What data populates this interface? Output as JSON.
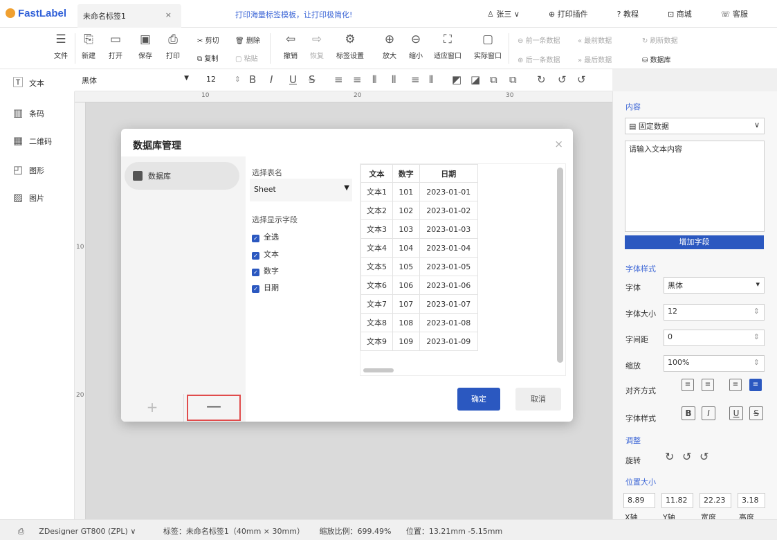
{
  "titlebar": {
    "app_name": "FastLabel",
    "doc_tab": "未命名标签1",
    "doc_close": "×",
    "promo": "打印海量标签模板，让打印极简化!",
    "user": "张三 ∨",
    "links": [
      "打印插件",
      "教程",
      "商城",
      "客服"
    ]
  },
  "toolbar": {
    "file": "文件",
    "new": "新建",
    "open": "打开",
    "save": "保存",
    "print": "打印",
    "cut": "剪切",
    "delete": "删除",
    "copy": "复制",
    "paste": "粘贴",
    "undo": "撤销",
    "redo": "恢复",
    "label_settings": "标签设置",
    "zoom_in": "放大",
    "zoom_out": "缩小",
    "fit_window": "适应窗口",
    "actual_window": "实际窗口",
    "prev_record": "前一条数据",
    "first_record": "最前数据",
    "refresh": "刷新数据",
    "next_record": "后一条数据",
    "last_record": "最后数据",
    "database": "数据库"
  },
  "format": {
    "font": "黑体",
    "size": "12"
  },
  "leftpanel": {
    "items": [
      "文本",
      "条码",
      "二维码",
      "图形",
      "图片"
    ]
  },
  "ruler": {
    "h": [
      "10",
      "20",
      "30"
    ],
    "v": [
      "10",
      "20"
    ]
  },
  "dialog": {
    "title": "数据库管理",
    "close": "×",
    "db_item": "数据库",
    "add": "+",
    "remove": "—",
    "select_table_label": "选择表名",
    "sheet_value": "Sheet",
    "select_fields_label": "选择显示字段",
    "fields": [
      "全选",
      "文本",
      "数字",
      "日期"
    ],
    "confirm": "确定",
    "cancel": "取消",
    "table": {
      "headers": [
        "文本",
        "数字",
        "日期"
      ],
      "rows": [
        [
          "文本1",
          "101",
          "2023-01-01"
        ],
        [
          "文本2",
          "102",
          "2023-01-02"
        ],
        [
          "文本3",
          "103",
          "2023-01-03"
        ],
        [
          "文本4",
          "104",
          "2023-01-04"
        ],
        [
          "文本5",
          "105",
          "2023-01-05"
        ],
        [
          "文本6",
          "106",
          "2023-01-06"
        ],
        [
          "文本7",
          "107",
          "2023-01-07"
        ],
        [
          "文本8",
          "108",
          "2023-01-08"
        ],
        [
          "文本9",
          "109",
          "2023-01-09"
        ]
      ]
    }
  },
  "rightpanel": {
    "content_title": "内容",
    "content_type": "固定数据",
    "content_placeholder": "请输入文本内容",
    "add_field": "增加字段",
    "font_style_title": "字体样式",
    "font_label": "字体",
    "font_value": "黑体",
    "size_label": "字体大小",
    "size_value": "12",
    "spacing_label": "字间距",
    "spacing_value": "0",
    "scale_label": "缩放",
    "scale_value": "100%",
    "align_label": "对齐方式",
    "style_label": "字体样式",
    "adjust_title": "调整",
    "rotate_label": "旋转",
    "pos_title": "位置大小",
    "x": "8.89",
    "y": "11.82",
    "w": "22.23",
    "h": "3.18",
    "x_label": "X轴",
    "y_label": "Y轴",
    "w_label": "宽度",
    "h_label": "高度"
  },
  "statusbar": {
    "printer": "ZDesigner GT800 (ZPL) ∨",
    "label": "标签：未命名标签1（40mm × 30mm）",
    "zoom": "缩放比例：699.49%",
    "position": "位置：13.21mm -5.15mm"
  },
  "colors": {
    "accent": "#2b58c0",
    "highlight": "#e04b4b"
  }
}
